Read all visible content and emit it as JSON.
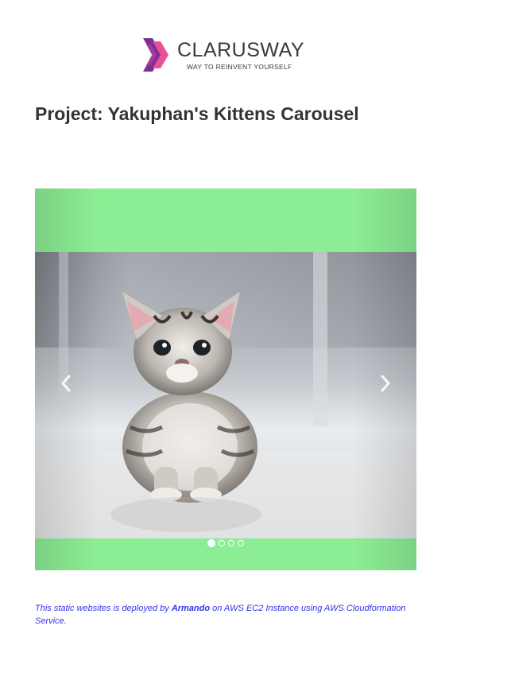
{
  "logo": {
    "brand": "CLARUSWAY",
    "tagline": "WAY TO REINVENT YOURSELF"
  },
  "page": {
    "title": "Project: Yakuphan's Kittens Carousel"
  },
  "carousel": {
    "slide_image": "kitten-photo",
    "active_slide": 1,
    "slide_count": 4,
    "background_color": "#8cee94",
    "prev_icon": "chevron-left-icon",
    "next_icon": "chevron-right-icon"
  },
  "footer": {
    "text_before": "This static websites is deployed by ",
    "author": "Armando",
    "text_after": " on AWS EC2 Instance using AWS Cloudformation Service.",
    "color": "#3333ee"
  }
}
